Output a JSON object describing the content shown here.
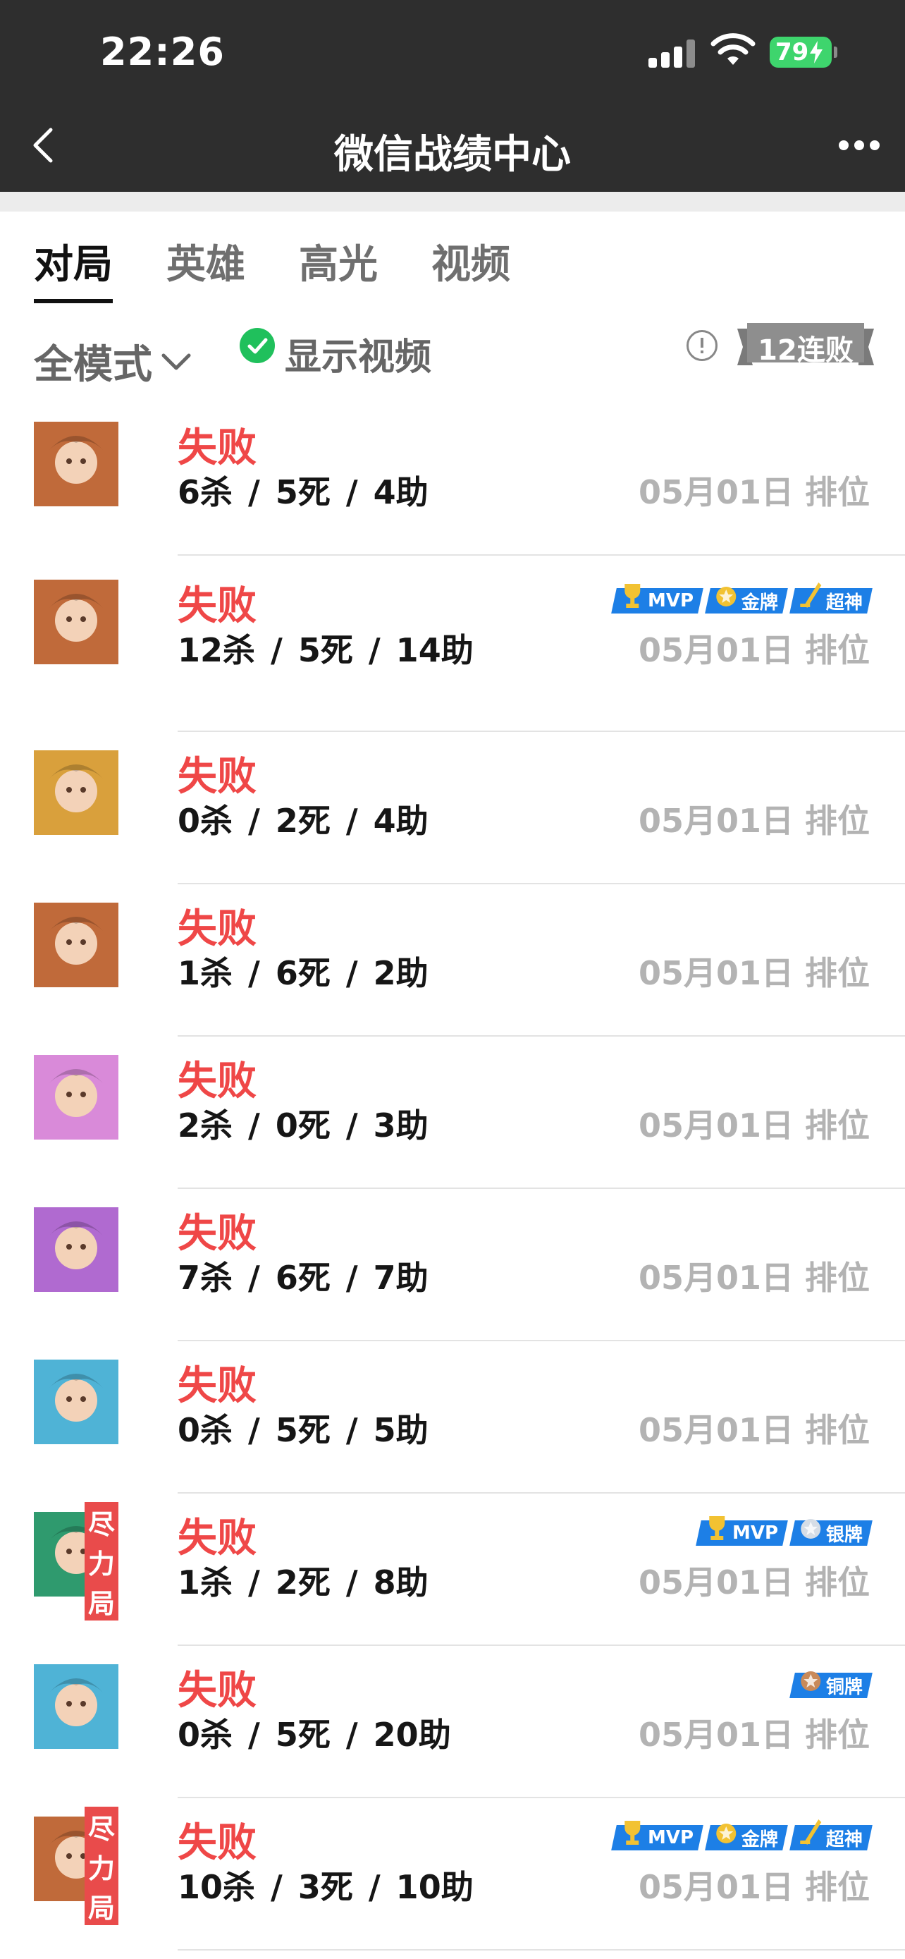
{
  "status_bar": {
    "time": "22:26",
    "battery": "79"
  },
  "nav": {
    "title": "微信战绩中心"
  },
  "tabs": [
    "对局",
    "英雄",
    "高光",
    "视频"
  ],
  "filters": {
    "mode_label": "全模式",
    "show_video_label": "显示视频",
    "streak_badge": "12连败"
  },
  "matches": [
    {
      "result": "失败",
      "kda": "6杀 / 5死 / 4助",
      "date": "05月01日",
      "mode": "排位",
      "avatar_color": "#c06a3a",
      "badges": []
    },
    {
      "result": "失败",
      "kda": "12杀 / 5死 / 14助",
      "date": "05月01日",
      "mode": "排位",
      "avatar_color": "#c06a3a",
      "badges": [
        "MVP",
        "金牌",
        "超神"
      ]
    },
    {
      "result": "失败",
      "kda": "0杀 / 2死 / 4助",
      "date": "05月01日",
      "mode": "排位",
      "avatar_color": "#d9a03c",
      "badges": []
    },
    {
      "result": "失败",
      "kda": "1杀 / 6死 / 2助",
      "date": "05月01日",
      "mode": "排位",
      "avatar_color": "#c06a3a",
      "badges": []
    },
    {
      "result": "失败",
      "kda": "2杀 / 0死 / 3助",
      "date": "05月01日",
      "mode": "排位",
      "avatar_color": "#d98ad9",
      "badges": []
    },
    {
      "result": "失败",
      "kda": "7杀 / 6死 / 7助",
      "date": "05月01日",
      "mode": "排位",
      "avatar_color": "#b06ad0",
      "badges": []
    },
    {
      "result": "失败",
      "kda": "0杀 / 5死 / 5助",
      "date": "05月01日",
      "mode": "排位",
      "avatar_color": "#4fb3d6",
      "badges": []
    },
    {
      "result": "失败",
      "kda": "1杀 / 2死 / 8助",
      "date": "05月01日",
      "mode": "排位",
      "avatar_color": "#2f9a6e",
      "badges": [
        "MVP",
        "银牌"
      ],
      "effort": "尽力局"
    },
    {
      "result": "失败",
      "kda": "0杀 / 5死 / 20助",
      "date": "05月01日",
      "mode": "排位",
      "avatar_color": "#4fb3d6",
      "badges": [
        "铜牌"
      ]
    },
    {
      "result": "失败",
      "kda": "10杀 / 3死 / 10助",
      "date": "05月01日",
      "mode": "排位",
      "avatar_color": "#c06a3a",
      "badges": [
        "MVP",
        "金牌",
        "超神"
      ],
      "effort": "尽力局"
    }
  ]
}
